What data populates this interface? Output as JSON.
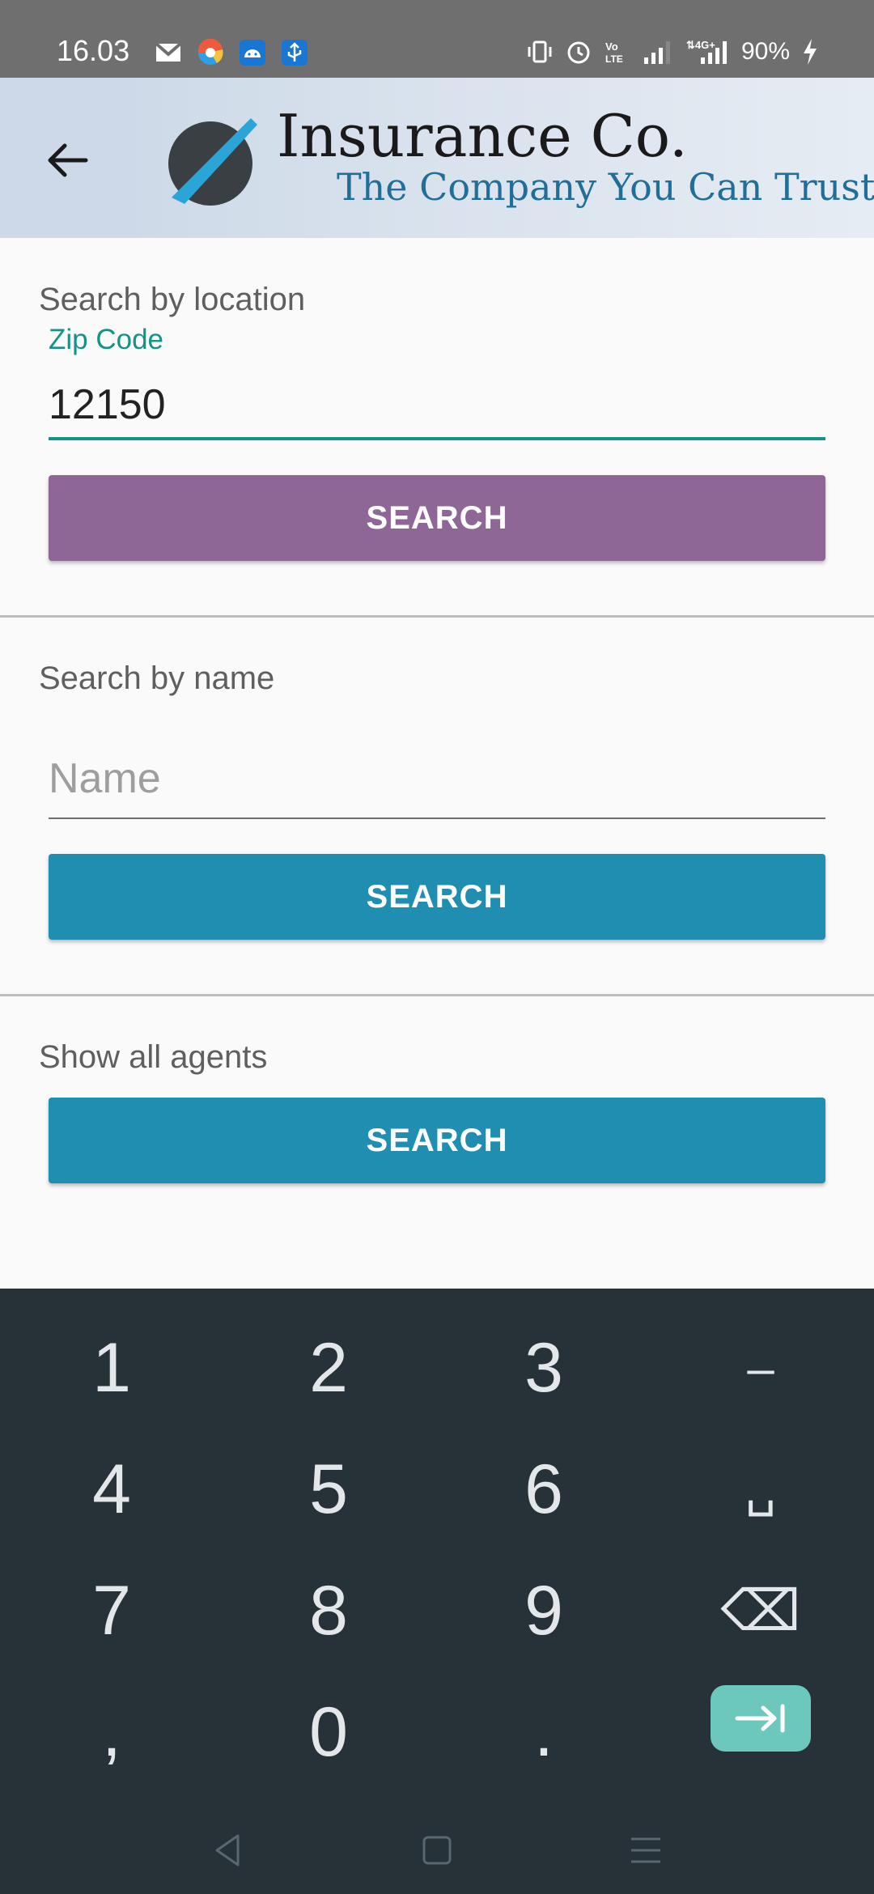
{
  "status_bar": {
    "time": "16.03",
    "battery": "90%",
    "network": "4G"
  },
  "header": {
    "brand_title": "Insurance Co.",
    "brand_tagline": "The Company You Can Trust"
  },
  "location_section": {
    "label": "Search by location",
    "field_label": "Zip Code",
    "field_value": "12150",
    "button_label": "SEARCH",
    "button_color": "#8e6797"
  },
  "name_section": {
    "label": "Search by name",
    "placeholder": "Name",
    "button_label": "SEARCH",
    "button_color": "#1f8eb1"
  },
  "agents_section": {
    "label": "Show all agents",
    "button_label": "SEARCH",
    "button_color": "#1f8eb1"
  },
  "keyboard": {
    "keys": [
      "1",
      "2",
      "3",
      "–",
      "4",
      "5",
      "6",
      "␣",
      "7",
      "8",
      "9",
      "⌫",
      ",",
      "0",
      "."
    ],
    "accent_color": "#6cc8bd"
  }
}
